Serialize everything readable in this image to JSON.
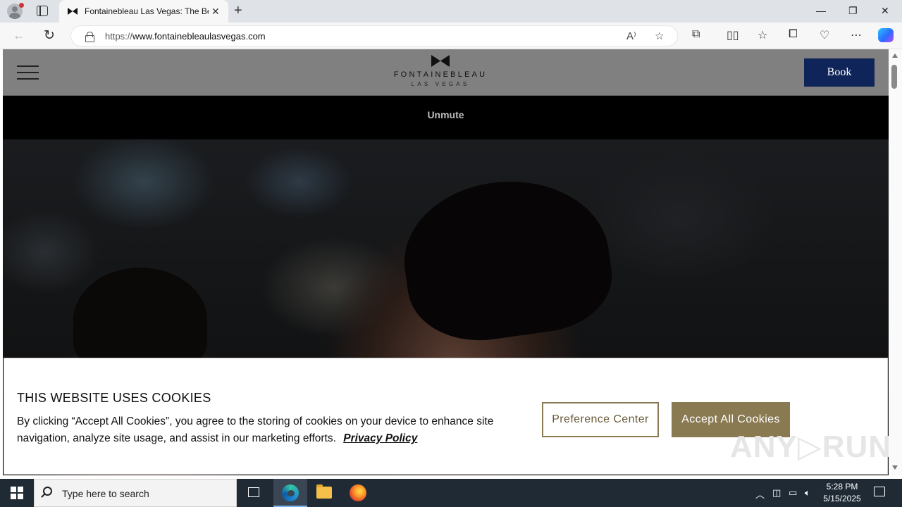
{
  "browser": {
    "tab_title": "Fontainebleau Las Vegas: The Bes",
    "tab_close": "✕",
    "new_tab": "+",
    "url_prefix": "https://",
    "url_domain": "www.fontainebleaulasvegas.com",
    "window_controls": {
      "minimize": "—",
      "restore": "❐",
      "close": "✕"
    },
    "icons": [
      "read-aloud-icon",
      "favorite-star-icon",
      "extensions-icon",
      "split-screen-icon",
      "favorites-icon",
      "collections-icon",
      "browser-essentials-icon",
      "more-menu-icon",
      "copilot-icon"
    ]
  },
  "site": {
    "brand_name": "FONTAINEBLEAU",
    "brand_sub": "LAS VEGAS",
    "book_label": "Book",
    "unmute_label": "Unmute"
  },
  "cookie_banner": {
    "title": "THIS WEBSITE USES COOKIES",
    "text": "By clicking “Accept All Cookies”, you agree to the storing of cookies on your device to enhance site navigation, analyze site usage, and assist in our marketing efforts.",
    "privacy_link": "Privacy Policy",
    "preference_label": "Preference Center",
    "accept_label": "Accept All Cookies",
    "accent_color": "#8a7a52"
  },
  "taskbar": {
    "search_placeholder": "Type here to search",
    "time": "5:28 PM",
    "date": "5/15/2025",
    "apps": [
      "task-view-icon",
      "edge-icon",
      "file-explorer-icon",
      "firefox-icon"
    ]
  }
}
